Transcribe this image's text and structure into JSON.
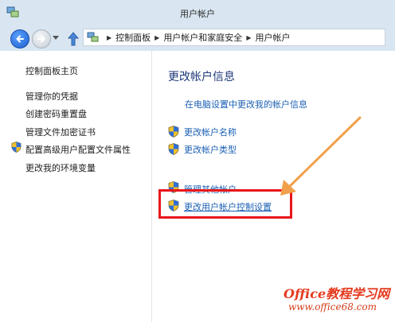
{
  "window": {
    "title": "用户帐户"
  },
  "navigation": {
    "breadcrumb": [
      "控制面板",
      "用户帐户和家庭安全",
      "用户帐户"
    ]
  },
  "sidebar": {
    "home": "控制面板主页",
    "items": [
      {
        "label": "管理你的凭据",
        "icon": "none"
      },
      {
        "label": "创建密码重置盘",
        "icon": "none"
      },
      {
        "label": "管理文件加密证书",
        "icon": "none"
      },
      {
        "label": "配置高级用户配置文件属性",
        "icon": "uac-shield-icon"
      },
      {
        "label": "更改我的环境变量",
        "icon": "none"
      }
    ]
  },
  "main": {
    "heading": "更改帐户信息",
    "pc_settings_link": "在电脑设置中更改我的帐户信息",
    "tasks": [
      {
        "label": "更改帐户名称",
        "icon": "uac-shield-icon"
      },
      {
        "label": "更改帐户类型",
        "icon": "uac-shield-icon"
      },
      {
        "label": "管理其他帐户",
        "icon": "uac-shield-icon"
      },
      {
        "label": "更改用户帐户控制设置",
        "icon": "uac-shield-icon"
      }
    ]
  },
  "annotation": {
    "highlight_color": "#e8161b",
    "arrow_color": "#f0a04b"
  },
  "watermark": {
    "line1": "Office教程学习网",
    "line2": "www.office68.com"
  }
}
